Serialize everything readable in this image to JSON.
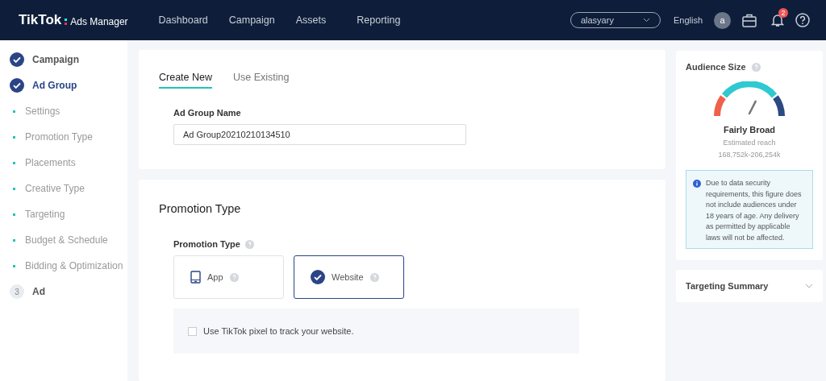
{
  "header": {
    "logo": "TikTok",
    "logo_suffix": "Ads Manager",
    "nav": [
      {
        "label": "Dashboard"
      },
      {
        "label": "Campaign"
      },
      {
        "label": "Assets"
      },
      {
        "label": "Reporting"
      }
    ],
    "account": "alasyary",
    "language": "English",
    "avatar": "a",
    "notifications": "2"
  },
  "sidebar": {
    "steps": [
      {
        "kind": "done",
        "label": "Campaign",
        "selected": false
      },
      {
        "kind": "done",
        "label": "Ad Group",
        "selected": true
      },
      {
        "kind": "sub",
        "label": "Settings",
        "selected": false
      },
      {
        "kind": "sub",
        "label": "Promotion Type",
        "selected": false
      },
      {
        "kind": "sub",
        "label": "Placements",
        "selected": false
      },
      {
        "kind": "sub",
        "label": "Creative Type",
        "selected": false
      },
      {
        "kind": "sub",
        "label": "Targeting",
        "selected": false
      },
      {
        "kind": "sub",
        "label": "Budget & Schedule",
        "selected": false
      },
      {
        "kind": "sub",
        "label": "Bidding & Optimization",
        "selected": false
      },
      {
        "kind": "number",
        "number": "3",
        "label": "Ad",
        "selected": false
      }
    ]
  },
  "ad_group": {
    "tabs": [
      {
        "label": "Create New",
        "selected": true
      },
      {
        "label": "Use Existing",
        "selected": false
      }
    ],
    "name_label": "Ad Group Name",
    "name_value": "Ad Group20210210134510"
  },
  "promotion": {
    "title": "Promotion Type",
    "field_label": "Promotion Type",
    "options": [
      {
        "label": "App",
        "selected": false
      },
      {
        "label": "Website",
        "selected": true
      }
    ],
    "pixel": {
      "label": "Use TikTok pixel to track your website.",
      "checked": false
    }
  },
  "audience": {
    "title": "Audience Size",
    "verdict": "Fairly Broad",
    "reach_label": "Estimated reach",
    "reach": "168,752k-206,254k",
    "notice": "Due to data security requirements, this figure does not include audiences under 18 years of age. Any delivery as permitted by applicable laws will not be affected."
  },
  "targeting_summary": {
    "title": "Targeting Summary",
    "expanded": false
  }
}
